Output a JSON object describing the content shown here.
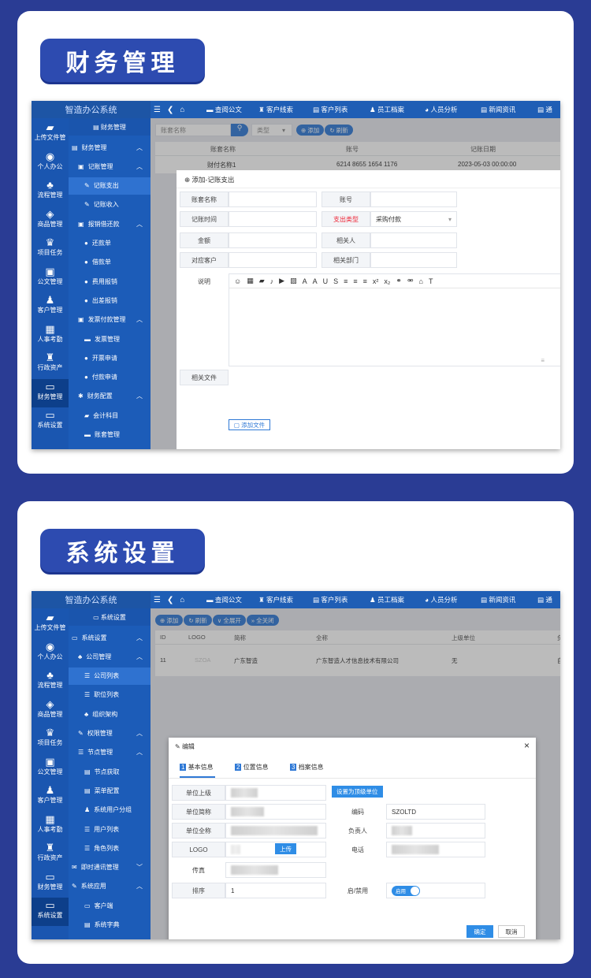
{
  "sections": {
    "finance_title": "财务管理",
    "settings_title": "系统设置"
  },
  "app": {
    "brand": "智造办公系统",
    "nav": [
      "查阅公文",
      "客户线索",
      "客户列表",
      "员工档案",
      "人员分析",
      "新闻资讯",
      "通"
    ]
  },
  "sidebar_icons": [
    "上传文件管",
    "个人办公",
    "流程管理",
    "商品管理",
    "项目任务",
    "公文管理",
    "客户管理",
    "人事考勤",
    "行政资产",
    "财务管理",
    "系统设置"
  ],
  "finance": {
    "menu_header": "财务管理",
    "menu": [
      {
        "label": "财务管理",
        "icon": "▤",
        "indent": 0,
        "arrow": "︿"
      },
      {
        "label": "记账管理",
        "icon": "▣",
        "indent": 1,
        "arrow": "︿"
      },
      {
        "label": "记账支出",
        "icon": "✎",
        "indent": 2,
        "sel": true
      },
      {
        "label": "记账收入",
        "icon": "✎",
        "indent": 2
      },
      {
        "label": "报销借还款",
        "icon": "▣",
        "indent": 1,
        "arrow": "︿"
      },
      {
        "label": "还款单",
        "icon": "●",
        "indent": 2
      },
      {
        "label": "借款单",
        "icon": "●",
        "indent": 2
      },
      {
        "label": "费用报销",
        "icon": "●",
        "indent": 2
      },
      {
        "label": "出差报销",
        "icon": "●",
        "indent": 2
      },
      {
        "label": "发票付款管理",
        "icon": "▣",
        "indent": 1,
        "arrow": "︿"
      },
      {
        "label": "发票管理",
        "icon": "▬",
        "indent": 2
      },
      {
        "label": "开票申请",
        "icon": "●",
        "indent": 2
      },
      {
        "label": "付款申请",
        "icon": "●",
        "indent": 2
      },
      {
        "label": "财务配置",
        "icon": "✱",
        "indent": 1,
        "arrow": "︿"
      },
      {
        "label": "会计科目",
        "icon": "▰",
        "indent": 2
      },
      {
        "label": "账套管理",
        "icon": "▬",
        "indent": 2
      }
    ],
    "search_placeholder": "账套名称",
    "type_placeholder": "类型",
    "add": "添加",
    "refresh": "刷新",
    "columns": [
      "账套名称",
      "账号",
      "记账日期"
    ],
    "row": [
      "财付名称1",
      "6214 8655 1654 1176",
      "2023-05-03 00:00:00"
    ],
    "modal": {
      "title": "添加-记账支出",
      "labels": {
        "account_name": "账套名称",
        "account_no": "账号",
        "time": "记账时间",
        "expense_type": "支出类型",
        "amount": "金额",
        "related_person": "相关人",
        "customer": "对应客户",
        "department": "相关部门",
        "desc": "说明",
        "files": "相关文件"
      },
      "expense_value": "采购付款",
      "add_file": "添加文件"
    }
  },
  "settings": {
    "menu_header": "系统设置",
    "menu": [
      {
        "label": "系统设置",
        "icon": "▭",
        "indent": 0,
        "arrow": "︿"
      },
      {
        "label": "公司管理",
        "icon": "♣",
        "indent": 1,
        "arrow": "︿"
      },
      {
        "label": "公司列表",
        "icon": "☰",
        "indent": 2,
        "sel": true
      },
      {
        "label": "职位列表",
        "icon": "☰",
        "indent": 2
      },
      {
        "label": "组织架构",
        "icon": "♣",
        "indent": 2
      },
      {
        "label": "权限管理",
        "icon": "✎",
        "indent": 1,
        "arrow": "︿"
      },
      {
        "label": "节点管理",
        "icon": "☰",
        "indent": 1,
        "arrow": "︿"
      },
      {
        "label": "节点获取",
        "icon": "▤",
        "indent": 2
      },
      {
        "label": "菜单配置",
        "icon": "▤",
        "indent": 2
      },
      {
        "label": "系统用户分组",
        "icon": "♟",
        "indent": 2
      },
      {
        "label": "用户列表",
        "icon": "☰",
        "indent": 2
      },
      {
        "label": "角色列表",
        "icon": "☰",
        "indent": 2
      },
      {
        "label": "即时通讯管理",
        "icon": "✉",
        "indent": 0,
        "arrow": "﹀"
      },
      {
        "label": "系统应用",
        "icon": "✎",
        "indent": 0,
        "arrow": "︿"
      },
      {
        "label": "客户端",
        "icon": "▭",
        "indent": 2
      },
      {
        "label": "系统字典",
        "icon": "▤",
        "indent": 2
      }
    ],
    "toolbar": [
      "添加",
      "刷新",
      "全展开",
      "全关闭"
    ],
    "columns": [
      "ID",
      "LOGO",
      "简称",
      "全称",
      "上级单位",
      "负"
    ],
    "row": [
      "11",
      "SZOA",
      "广东智造",
      "广东智造人才信息技术有限公司",
      "无",
      "自"
    ],
    "modal": {
      "title": "编辑",
      "tabs": [
        "基本信息",
        "位置信息",
        "档案信息"
      ],
      "tab_nums": [
        "1",
        "2",
        "3"
      ],
      "labels": {
        "parent": "单位上级",
        "short": "单位简称",
        "full": "单位全称",
        "logo": "LOGO",
        "fax": "传真",
        "order": "排序",
        "code": "编码",
        "owner": "负责人",
        "phone": "电话",
        "enable": "启/禁用"
      },
      "set_top": "设置为顶级单位",
      "upload": "上传",
      "code_value": "SZOLTD",
      "order_value": "1",
      "toggle_label": "启用",
      "ok": "确定",
      "cancel": "取消",
      "close": "×"
    }
  }
}
